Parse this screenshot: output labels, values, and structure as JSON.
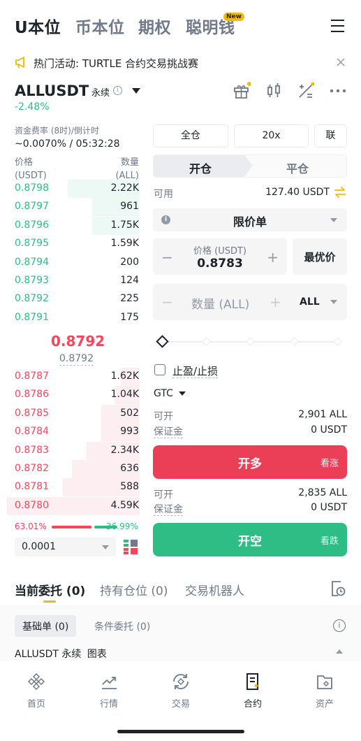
{
  "top_tabs": [
    "U本位",
    "币本位",
    "期权",
    "聪明钱"
  ],
  "new_badge": "New",
  "announcement": "热门活动: TURTLE 合约交易挑战赛",
  "symbol": {
    "name": "ALLUSDT",
    "type": "永续",
    "change": "-2.48%"
  },
  "funding": {
    "label": "资金费率 (8时)/倒计时",
    "value": "~0.0070% / 05:32:28"
  },
  "orderbook": {
    "price_header": "价格",
    "price_unit": "(USDT)",
    "qty_header": "数量",
    "qty_unit": "(ALL)",
    "asks": [
      {
        "price": "0.8798",
        "qty": "2.22K",
        "depth": 0.54
      },
      {
        "price": "0.8797",
        "qty": "961",
        "depth": 0.36
      },
      {
        "price": "0.8796",
        "qty": "1.75K",
        "depth": 0.36
      },
      {
        "price": "0.8795",
        "qty": "1.59K",
        "depth": 0
      },
      {
        "price": "0.8794",
        "qty": "200",
        "depth": 0
      },
      {
        "price": "0.8793",
        "qty": "124",
        "depth": 0
      },
      {
        "price": "0.8792",
        "qty": "225",
        "depth": 0
      },
      {
        "price": "0.8791",
        "qty": "175",
        "depth": 0
      }
    ],
    "mid_price": "0.8792",
    "mark_price": "0.8792",
    "bids": [
      {
        "price": "0.8787",
        "qty": "1.62K",
        "depth": 0.14
      },
      {
        "price": "0.8786",
        "qty": "1.04K",
        "depth": 0.19
      },
      {
        "price": "0.8785",
        "qty": "502",
        "depth": 0.29
      },
      {
        "price": "0.8784",
        "qty": "993",
        "depth": 0.29
      },
      {
        "price": "0.8783",
        "qty": "2.34K",
        "depth": 0.4
      },
      {
        "price": "0.8782",
        "qty": "636",
        "depth": 0.51
      },
      {
        "price": "0.8781",
        "qty": "588",
        "depth": 0.58
      },
      {
        "price": "0.8780",
        "qty": "4.59K",
        "depth": 1.0
      }
    ],
    "buy_ratio": "63.01%",
    "sell_ratio": "36.99%",
    "buy_ratio_value": 0.6301,
    "precision": "0.0001"
  },
  "form": {
    "margin_mode": "全仓",
    "leverage": "20x",
    "asset_mode": "联",
    "open_tab": "开仓",
    "close_tab": "平仓",
    "available_label": "可用",
    "available_value": "127.40 USDT",
    "order_type": "限价单",
    "price_label": "价格 (USDT)",
    "price_value": "0.8783",
    "best_price": "最优价",
    "qty_placeholder": "数量 (ALL)",
    "qty_unit": "ALL",
    "tpsl_label": "止盈/止损",
    "tif": "GTC",
    "long": {
      "can_open_label": "可开",
      "can_open_value": "2,901 ALL",
      "margin_label": "保证金",
      "margin_value": "0 USDT",
      "button": "开多",
      "button_sub": "看涨"
    },
    "short": {
      "can_open_label": "可开",
      "can_open_value": "2,835 ALL",
      "margin_label": "保证金",
      "margin_value": "0 USDT",
      "button": "开空",
      "button_sub": "看跌"
    }
  },
  "bottom_tabs": [
    "当前委托 (0)",
    "持有仓位 (0)",
    "交易机器人"
  ],
  "sub_tabs": [
    "基础单 (0)",
    "条件委托 (0)"
  ],
  "order_filter": {
    "symbol": "ALLUSDT",
    "type": "永续",
    "chart": "图表"
  },
  "nav": [
    {
      "label": "首页",
      "icon": "binance-logo-icon"
    },
    {
      "label": "行情",
      "icon": "chart-trend-icon"
    },
    {
      "label": "交易",
      "icon": "exchange-icon"
    },
    {
      "label": "合约",
      "icon": "futures-icon"
    },
    {
      "label": "资产",
      "icon": "wallet-icon"
    }
  ],
  "colors": {
    "accent": "#f0b90b",
    "buy": "#2ebd85",
    "sell": "#f6465d",
    "buy_button": "#2ebd85",
    "sell_button": "#ea3f56"
  }
}
